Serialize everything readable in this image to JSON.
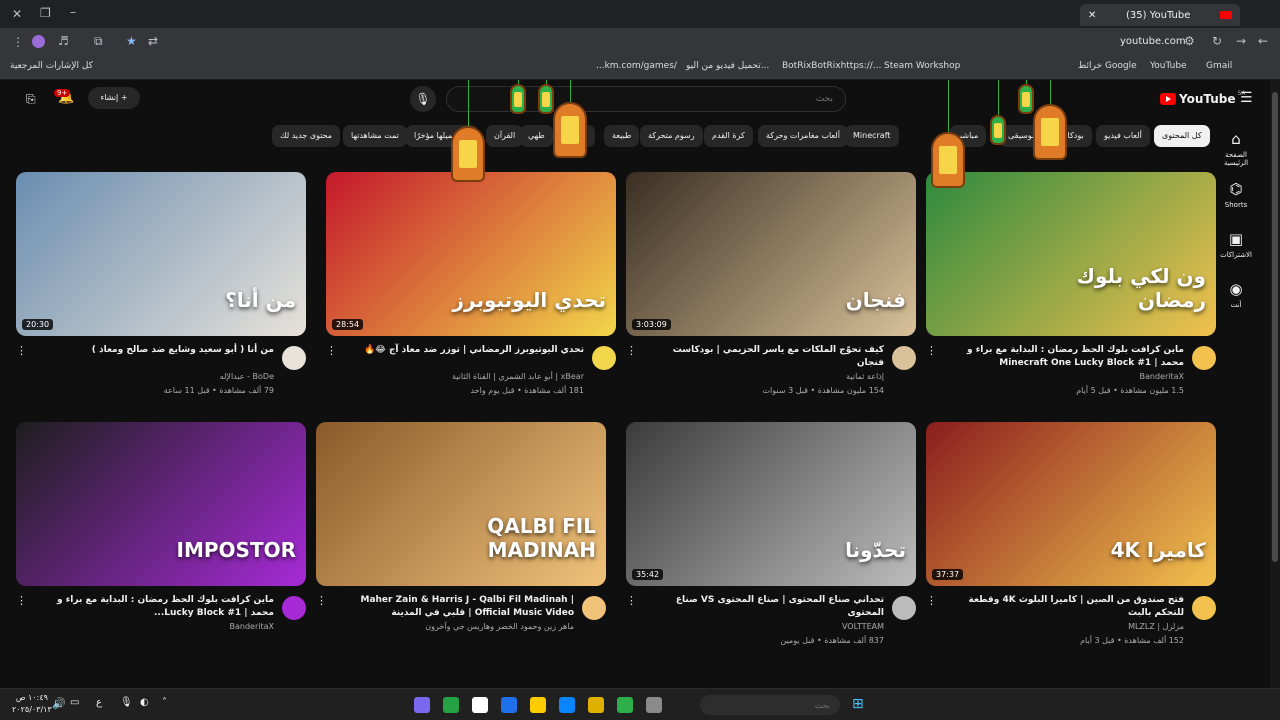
{
  "browser": {
    "tab_title": "(35) YouTube",
    "tab_plus": "+",
    "address": "youtube.com",
    "bookmarks": [
      {
        "label": "Gmail"
      },
      {
        "label": "YouTube"
      },
      {
        "label": "خرائط Google"
      },
      {
        "label": "Steam Workshop"
      },
      {
        "label": "BotRixBotRixhttps://..."
      },
      {
        "label": "تحميل فيديو من اليو..."
      },
      {
        "label": "...km.com/games/"
      },
      {
        "label": "كل الإشارات المرجعية"
      }
    ]
  },
  "youtube": {
    "logo_text": "YouTube",
    "region": "SA",
    "search_placeholder": "بحث",
    "create_label": "إنشاء",
    "notif_count": "9+",
    "chips": [
      {
        "label": "كل المحتوى",
        "active": true
      },
      {
        "label": "ألعاب فيديو"
      },
      {
        "label": "بودكاست"
      },
      {
        "label": "موسيقى"
      },
      {
        "label": "مباشر"
      },
      {
        "label": "Minecraft"
      },
      {
        "label": "ألعاب مغامرات وحركة"
      },
      {
        "label": "كرة القدم"
      },
      {
        "label": "رسوم متحركة"
      },
      {
        "label": "طبيعة"
      },
      {
        "label": "سياحة"
      },
      {
        "label": "طهي"
      },
      {
        "label": "القرآن"
      },
      {
        "label": "تم تحميلها مؤخرًا"
      },
      {
        "label": "تمت مشاهدتها"
      },
      {
        "label": "محتوى جديد لك"
      }
    ],
    "sidebar": [
      {
        "label": "الصفحة الرئيسية",
        "icon": "home-icon"
      },
      {
        "label": "Shorts",
        "icon": "shorts-icon"
      },
      {
        "label": "الاشتراكات",
        "icon": "subscriptions-icon"
      },
      {
        "label": "أنت",
        "icon": "you-icon"
      }
    ],
    "videos": [
      {
        "title": "ماين كرافت بلوك الحظ رمضان : البداية مع براء و محمد | Minecraft One Lucky Block #1",
        "channel": "BanderitaX",
        "views": "1.5 مليون مشاهدة • قبل 5 أيام",
        "duration": "",
        "thumb_text": "ون لكي بلوك رمضان",
        "colors": [
          "#2d8a3e",
          "#f2c14e"
        ]
      },
      {
        "title": "كيف تحوّج الملكات مع ياسر الحزيمي | بودكاست فنجان",
        "channel": "إذاعة ثمانية",
        "views": "154 مليون مشاهدة • قبل 3 سنوات",
        "duration": "3:03:09",
        "thumb_text": "فنجان",
        "colors": [
          "#3a2e22",
          "#d9c29a"
        ]
      },
      {
        "title": "تحدي اليوتيوبرز الرمضاني | توزر ضد معاذ آج 😂🔥",
        "channel": "xBear | أبو عابد الشمري | القناة الثانية",
        "views": "181 ألف مشاهدة • قبل يوم واحد",
        "duration": "28:54",
        "thumb_text": "تحدي اليوتيوبرز",
        "colors": [
          "#c4182b",
          "#f2d64b"
        ]
      },
      {
        "title": "من أنا ( أبو سعيد وشايع ضد صالح ومعاذ )",
        "channel": "BoDe - عبدالإله",
        "views": "79 ألف مشاهدة • قبل 11 ساعة",
        "duration": "20:30",
        "thumb_text": "من أنا؟",
        "colors": [
          "#6a8db0",
          "#e7e2da"
        ]
      },
      {
        "title": "فتح صندوق من الصين | كاميرا البلوث 4K وقطعة للتحكم بالبث",
        "channel": "مزلزل | MLZLZ",
        "views": "152 ألف مشاهدة • قبل 3 أيام",
        "duration": "37:37",
        "thumb_text": "كاميرا 4K",
        "colors": [
          "#8a1d1d",
          "#f2c14e"
        ]
      },
      {
        "title": "تحداني صناع المحتوى | صناع المحتوى VS صناع المحتوى",
        "channel": "VOLTTEAM",
        "views": "837 ألف مشاهدة • قبل يومين",
        "duration": "35:42",
        "thumb_text": "تحدّونا",
        "colors": [
          "#3b3b3b",
          "#bcbcbc"
        ]
      },
      {
        "title": "Maher Zain & Harris J - Qalbi Fil Madinah | Official Music Video | قلبي في المدينة",
        "channel": "ماهر زين وحمود الخضر وهاريس جي وآخرون",
        "views": "",
        "duration": "",
        "thumb_text": "QALBI FIL MADINAH",
        "colors": [
          "#8a5a2b",
          "#f0c27a"
        ]
      },
      {
        "title": "ماين كرافت بلوك الحظ رمضان : البداية مع براء و محمد | Lucky Block #1...",
        "channel": "BanderitaX",
        "views": "",
        "duration": "",
        "thumb_text": "IMPOSTOR",
        "colors": [
          "#1e1e1e",
          "#a62ad6"
        ]
      }
    ]
  },
  "taskbar": {
    "search_placeholder": "بحث",
    "time": "١٠:٤٩ ص",
    "date": "٢٠٢٥/٠٣/١٣",
    "lang": "ع"
  }
}
